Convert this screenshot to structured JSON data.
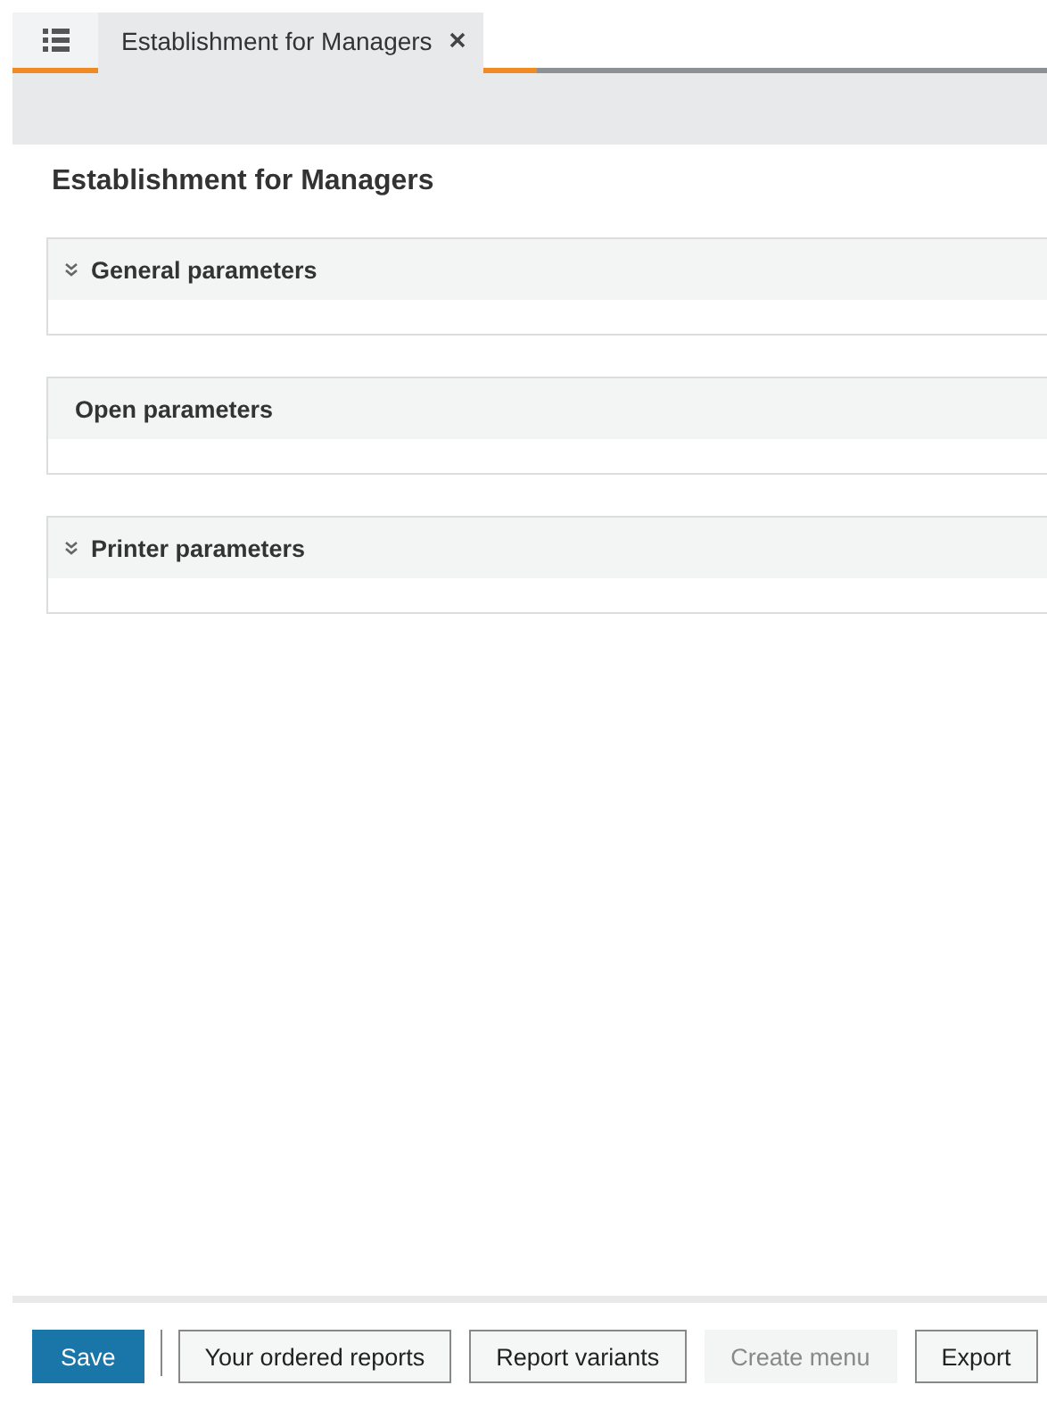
{
  "tabs": [
    {
      "kind": "menu",
      "selected": false
    },
    {
      "kind": "document",
      "label": "Establishment for Managers",
      "selected": true,
      "closable": true
    }
  ],
  "page_title": "Establishment for Managers",
  "sections": [
    {
      "title": "General parameters",
      "collapsible": true
    },
    {
      "title": "Open parameters",
      "collapsible": false
    },
    {
      "title": "Printer parameters",
      "collapsible": true
    }
  ],
  "buttons": [
    {
      "label": "Save",
      "kind": "primary",
      "disabled": false
    },
    {
      "label": "Your ordered reports",
      "kind": "default",
      "disabled": false
    },
    {
      "label": "Report variants",
      "kind": "default",
      "disabled": false
    },
    {
      "label": "Create menu",
      "kind": "default",
      "disabled": true
    },
    {
      "label": "Export",
      "kind": "default",
      "disabled": false
    }
  ]
}
